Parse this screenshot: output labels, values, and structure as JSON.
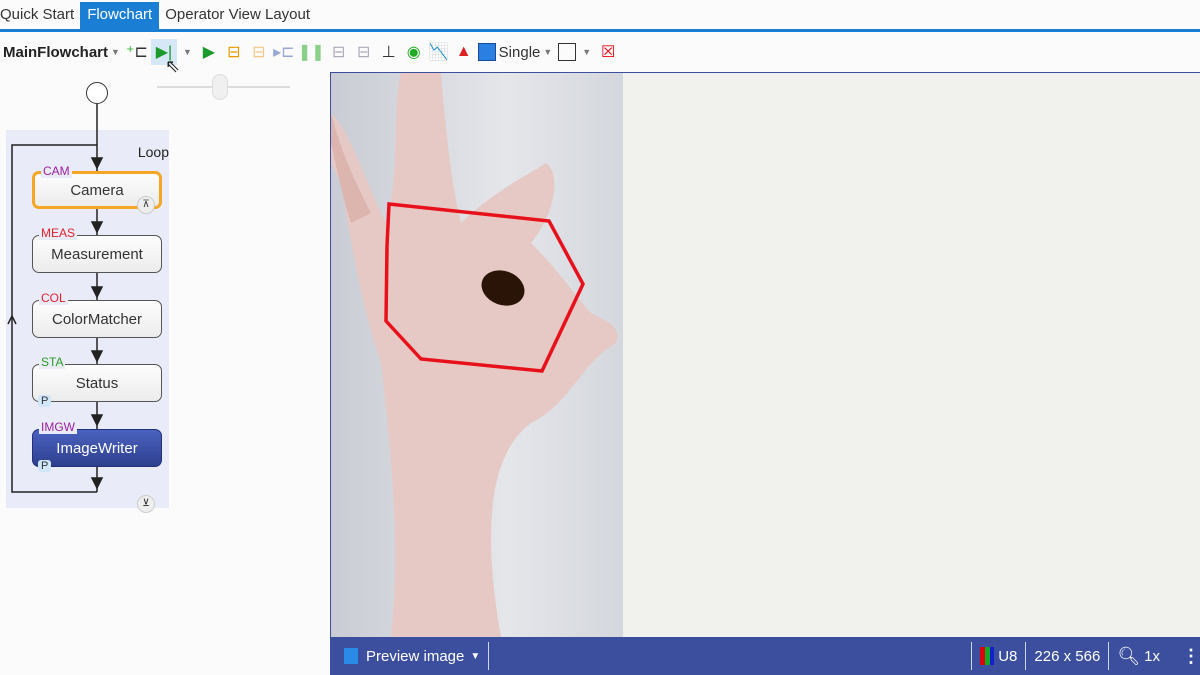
{
  "tabs": [
    {
      "label": "Quick Start"
    },
    {
      "label": "Flowchart",
      "active": true
    },
    {
      "label": "Operator View Layout"
    }
  ],
  "toolbar": {
    "flowchart_select": "MainFlowchart",
    "display_mode": "Single"
  },
  "flowchart": {
    "loop_label": "Loop",
    "nodes": [
      {
        "tag": "CAM",
        "label": "Camera",
        "tag_color": "#9b1fa0"
      },
      {
        "tag": "MEAS",
        "label": "Measurement",
        "tag_color": "#e0202e"
      },
      {
        "tag": "COL",
        "label": "ColorMatcher",
        "tag_color": "#e0202e"
      },
      {
        "tag": "STA",
        "label": "Status",
        "tag_color": "#2a9a2a",
        "p": "P"
      },
      {
        "tag": "IMGW",
        "label": "ImageWriter",
        "tag_color": "#9b1fa0",
        "p": "P"
      }
    ]
  },
  "statusbar": {
    "view_select": "Preview image",
    "pixel_type": "U8",
    "dimensions": "226 x 566",
    "zoom": "1x"
  },
  "colors": {
    "accent": "#1a7fd4",
    "statusbar": "#3c4f9f",
    "roi": "#e8101a",
    "selected_node": "#f5a623",
    "active_node": "#3a4fa8"
  }
}
